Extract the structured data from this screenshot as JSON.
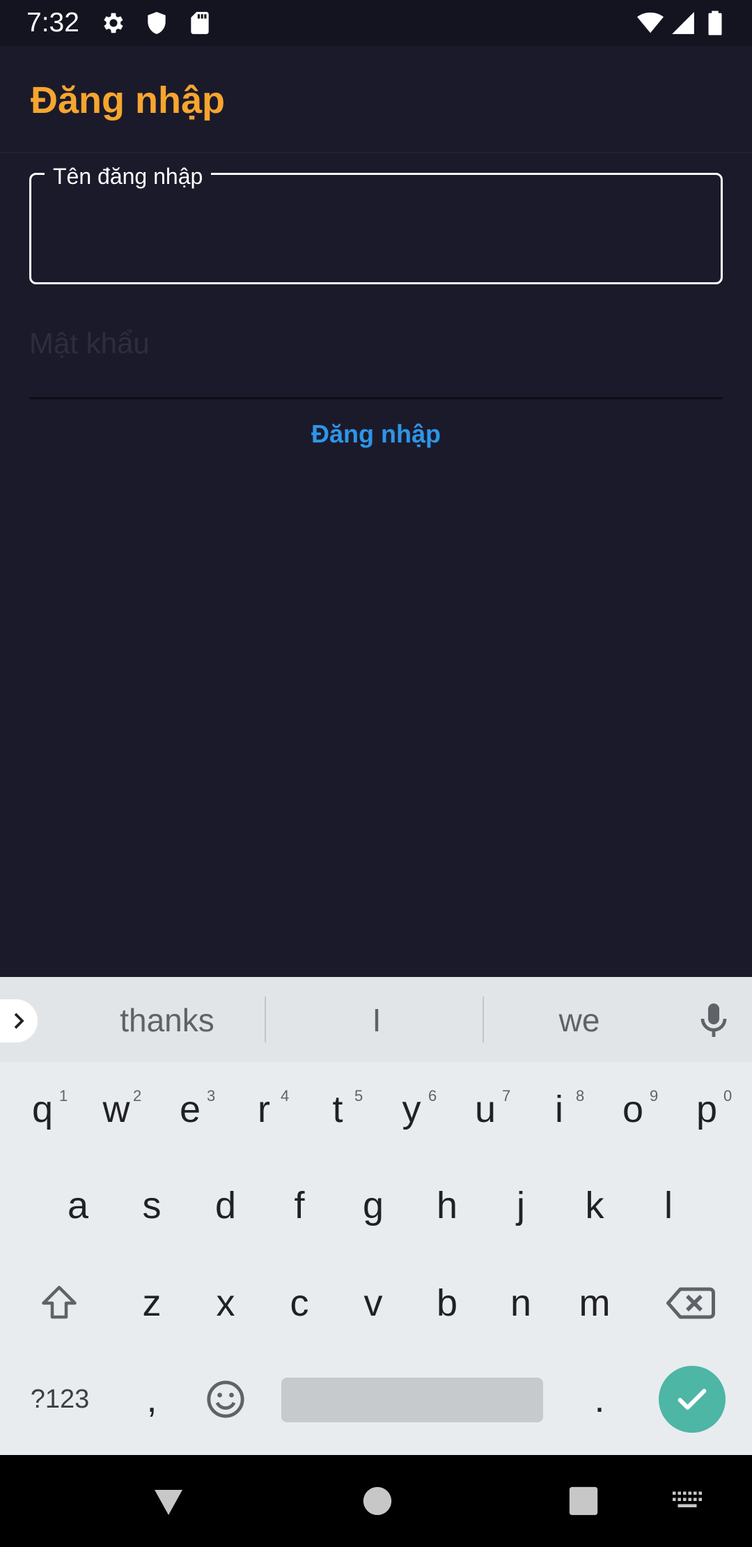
{
  "status_bar": {
    "time": "7:32",
    "icons": [
      "gear-icon",
      "shield-icon",
      "sd-card-icon",
      "wifi-icon",
      "signal-icon",
      "battery-icon"
    ]
  },
  "app_bar": {
    "title": "Đăng nhập",
    "title_color": "#f6a52f"
  },
  "form": {
    "username_label": "Tên đăng nhập",
    "username_value": "",
    "password_placeholder": "Mật khẩu",
    "login_button": "Đăng nhập",
    "login_color": "#2e95e8"
  },
  "keyboard": {
    "suggestions": [
      "thanks",
      "I",
      "we"
    ],
    "row1": [
      {
        "key": "q",
        "hint": "1"
      },
      {
        "key": "w",
        "hint": "2"
      },
      {
        "key": "e",
        "hint": "3"
      },
      {
        "key": "r",
        "hint": "4"
      },
      {
        "key": "t",
        "hint": "5"
      },
      {
        "key": "y",
        "hint": "6"
      },
      {
        "key": "u",
        "hint": "7"
      },
      {
        "key": "i",
        "hint": "8"
      },
      {
        "key": "o",
        "hint": "9"
      },
      {
        "key": "p",
        "hint": "0"
      }
    ],
    "row2": [
      "a",
      "s",
      "d",
      "f",
      "g",
      "h",
      "j",
      "k",
      "l"
    ],
    "row3": [
      "z",
      "x",
      "c",
      "v",
      "b",
      "n",
      "m"
    ],
    "symbols_key": "?123",
    "comma_key": ",",
    "period_key": ".",
    "enter_color": "#4db6a5"
  },
  "nav_bar": {
    "icons": [
      "back-icon",
      "home-icon",
      "recents-icon",
      "keyboard-switch-icon"
    ]
  }
}
